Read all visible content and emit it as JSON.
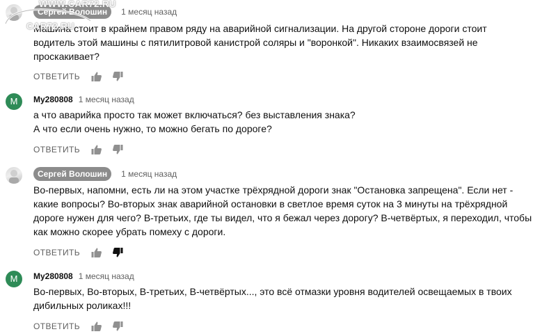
{
  "watermark": {
    "top": "WWW.CAR72.RU",
    "bottom": "CAR72.RU"
  },
  "comments": [
    {
      "author": "Сергей Волошин",
      "time": "1 месяц назад",
      "lines": [
        "Машина стоит в крайнем правом ряду на аварийной сигнализации. На другой стороне дороги стоит",
        "водитель этой машины с пятилитровой канистрой соляры и \"воронкой\". Никаких взаимосвязей не",
        "проскакивает?"
      ],
      "reply_label": "ОТВЕТИТЬ"
    },
    {
      "author": "My280808",
      "avatar_letter": "M",
      "time": "1 месяц назад",
      "lines": [
        "а что аварийка просто так может включаться? без выставления знака?",
        "А что если очень нужно, то можно бегать по дороге?"
      ],
      "reply_label": "ОТВЕТИТЬ"
    },
    {
      "author": "Сергей Волошин",
      "time": "1 месяц назад",
      "lines": [
        "Во-первых, напомни, есть ли на этом участке трёхрядной дороги знак \"Остановка запрещена\". Если нет -",
        "какие вопросы? Во-вторых знак аварийной остановки в светлое время суток на 3 минуты на трёхрядной",
        "дороге нужен для чего? В-третьих, где ты видел, что я бежал через дорогу? В-четвёртых, я переходил, чтобы",
        "как можно скорее убрать помеху с дороги."
      ],
      "reply_label": "ОТВЕТИТЬ",
      "disliked": true
    },
    {
      "author": "My280808",
      "avatar_letter": "M",
      "time": "1 месяц назад",
      "lines": [
        "Во-первых, Во-вторых, В-третьих,  В-четвёртых..., это всё отмазки уровня водителей  освещаемых в твоих",
        "дибильных роликах!!!"
      ],
      "reply_label": "ОТВЕТИТЬ"
    }
  ],
  "colors": {
    "chip_bg": "#8c8c8c",
    "letter_avatar_bg": "#2e8b57",
    "muted_text": "#606060",
    "icon_idle": "#909090",
    "icon_active": "#0f0f0f"
  },
  "icons": {
    "like": "thumb-up-icon",
    "dislike": "thumb-down-icon"
  }
}
